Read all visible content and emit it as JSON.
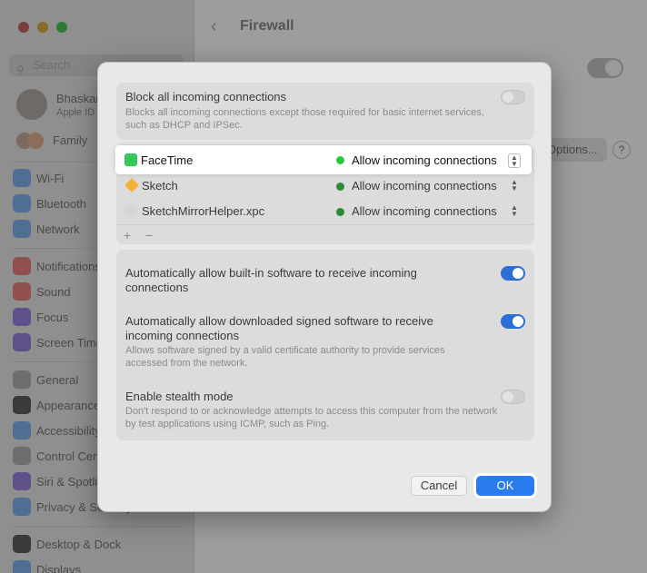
{
  "background": {
    "window_title": "Firewall",
    "search_placeholder": "Search",
    "user": {
      "name": "Bhaskar",
      "subtitle": "Apple ID"
    },
    "family_label": "Family",
    "sidebar_items": [
      "Wi-Fi",
      "Bluetooth",
      "Network",
      "Notifications",
      "Sound",
      "Focus",
      "Screen Time",
      "General",
      "Appearance",
      "Accessibility",
      "Control Centre",
      "Siri & Spotlight",
      "Privacy & Security",
      "Desktop & Dock",
      "Displays"
    ],
    "options_button": "Options...",
    "help_button": "?"
  },
  "dialog": {
    "block_all": {
      "title": "Block all incoming connections",
      "description": "Blocks all incoming connections except those required for basic internet services, such as DHCP and IPSec.",
      "enabled": false
    },
    "apps": [
      {
        "name": "FaceTime",
        "status": "Allow incoming connections",
        "status_color": "#28c840",
        "icon_color": "#34c759",
        "highlighted": true
      },
      {
        "name": "Sketch",
        "status": "Allow incoming connections",
        "status_color": "#2a8a36",
        "icon_color": "#f2b233",
        "highlighted": false
      },
      {
        "name": "SketchMirrorHelper.xpc",
        "status": "Allow incoming connections",
        "status_color": "#2a8a36",
        "icon_color": "#d5d5d5",
        "highlighted": false
      }
    ],
    "add_label": "+",
    "remove_label": "−",
    "auto_builtin": {
      "title": "Automatically allow built-in software to receive incoming connections",
      "enabled": true
    },
    "auto_signed": {
      "title": "Automatically allow downloaded signed software to receive incoming connections",
      "description": "Allows software signed by a valid certificate authority to provide services accessed from the network.",
      "enabled": true
    },
    "stealth": {
      "title": "Enable stealth mode",
      "description": "Don't respond to or acknowledge attempts to access this computer from the network by test applications using ICMP, such as Ping.",
      "enabled": false
    },
    "cancel_label": "Cancel",
    "ok_label": "OK"
  },
  "colors": {
    "accent": "#2a7bf0",
    "toggle_on": "#2b6fd6"
  }
}
